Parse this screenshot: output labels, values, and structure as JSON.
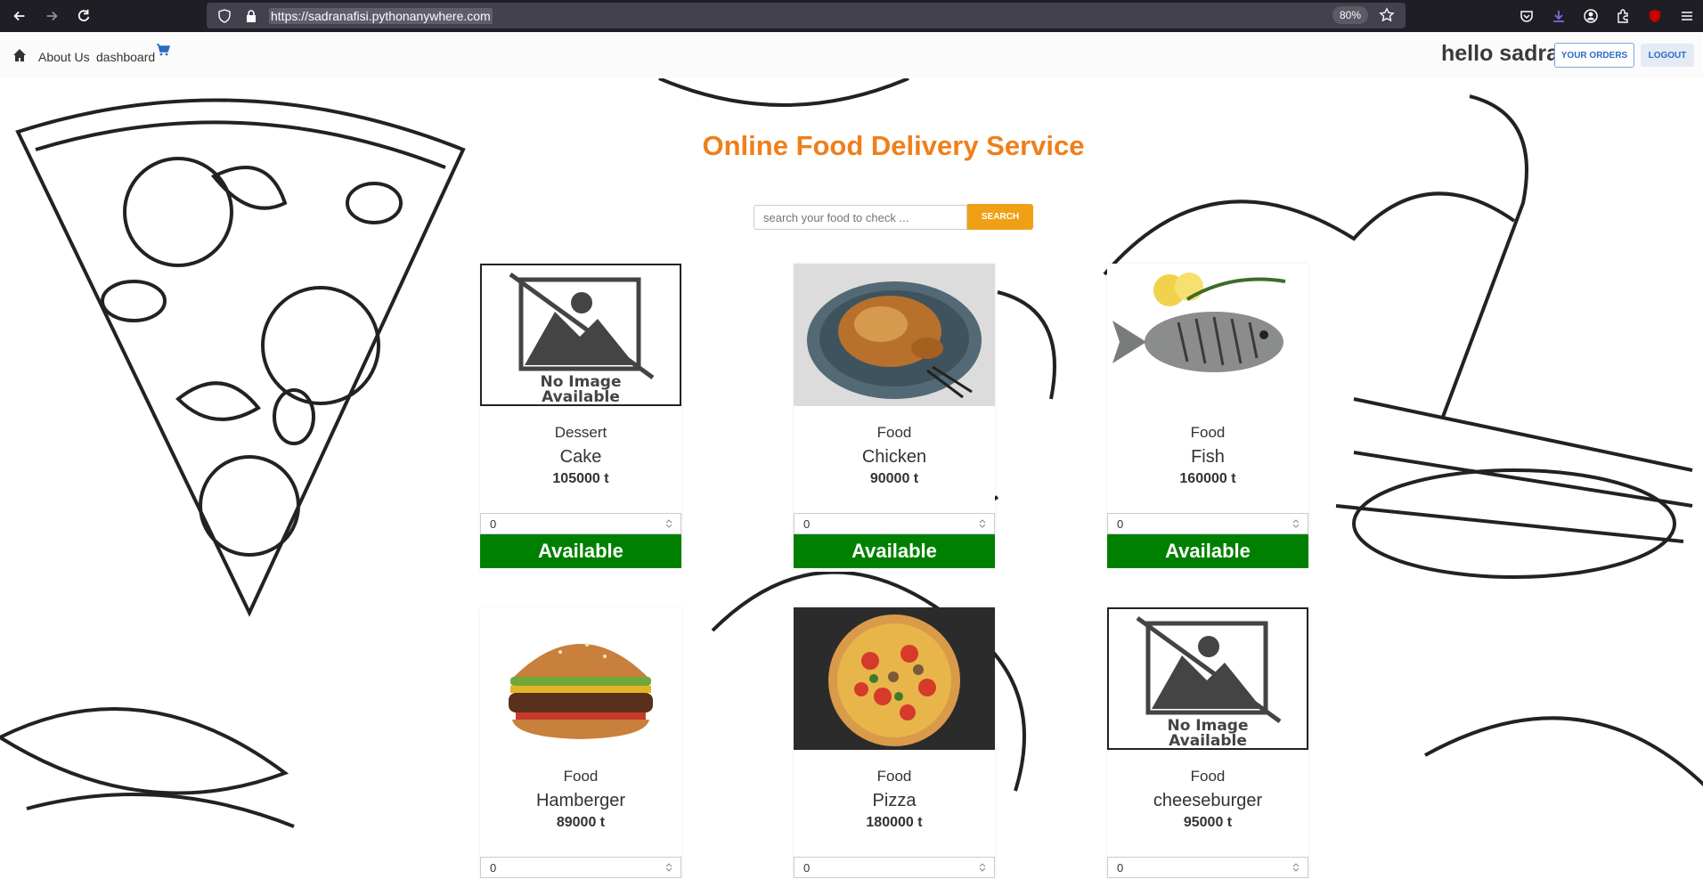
{
  "browser": {
    "url": "https://sadranafisi.pythonanywhere.com",
    "zoom": "80%"
  },
  "nav": {
    "about": "About Us",
    "dashboard": "dashboard",
    "greeting": "hello sadra",
    "orders_button": "YOUR ORDERS",
    "logout_button": "LOGOUT"
  },
  "main": {
    "title": "Online Food Delivery Service",
    "search_placeholder": "search your food to check ...",
    "search_button": "SEARCH"
  },
  "items": [
    {
      "category": "Dessert",
      "name": "Cake",
      "price": "105000 t",
      "qty": "0",
      "status": "Available",
      "image": "no-image"
    },
    {
      "category": "Food",
      "name": "Chicken",
      "price": "90000 t",
      "qty": "0",
      "status": "Available",
      "image": "chicken"
    },
    {
      "category": "Food",
      "name": "Fish",
      "price": "160000 t",
      "qty": "0",
      "status": "Available",
      "image": "fish"
    },
    {
      "category": "Food",
      "name": "Hamberger",
      "price": "89000 t",
      "qty": "0",
      "status": "",
      "image": "burger"
    },
    {
      "category": "Food",
      "name": "Pizza",
      "price": "180000 t",
      "qty": "0",
      "status": "",
      "image": "pizza"
    },
    {
      "category": "Food",
      "name": "cheeseburger",
      "price": "95000 t",
      "qty": "0",
      "status": "",
      "image": "no-image"
    }
  ],
  "no_image_text": [
    "No Image",
    "Available"
  ],
  "colors": {
    "accent": "#ef7f1a",
    "available": "#008000",
    "search": "#f0a014"
  }
}
